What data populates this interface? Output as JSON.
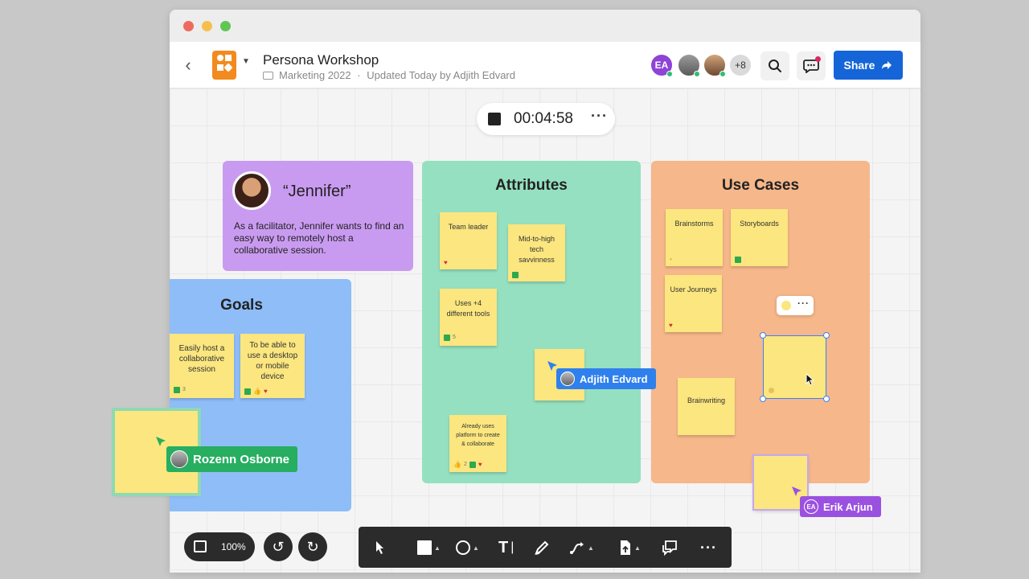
{
  "window": {
    "title": "Persona Workshop",
    "folder": "Marketing 2022",
    "updated": "Updated Today by Adjith Edvard"
  },
  "header": {
    "avatar_initials": "EA",
    "more_collaborators": "+8",
    "share_label": "Share"
  },
  "timer": {
    "time": "00:04:58"
  },
  "persona": {
    "name": "“Jennifer”",
    "description": "As a facilitator, Jennifer wants to find an easy way to remotely host a collaborative session."
  },
  "frames": {
    "attributes_title": "Attributes",
    "usecases_title": "Use Cases",
    "goals_title": "Goals"
  },
  "stickies": {
    "team_leader": "Team leader",
    "tech_savvy": "Mid-to-high tech savvinness",
    "uses_tools": "Uses +4 different tools",
    "uses_tools_votes": "5",
    "already_uses": "Already uses platform to create & collaborate",
    "already_uses_votes": "2",
    "brainstorms": "Brainstorms",
    "storyboards": "Storyboards",
    "user_journeys": "User Journeys",
    "brainwriting": "Brainwriting",
    "easily_host": "Easily host a collaborative session",
    "easily_host_votes": "3",
    "desktop_mobile": "To be able to use a desktop or mobile device"
  },
  "cursors": {
    "adjith": "Adjith Edvard",
    "rozenn": "Rozenn Osborne",
    "erik": "Erik Arjun",
    "erik_initials": "EA"
  },
  "bottom": {
    "zoom": "100%"
  },
  "colors": {
    "share_blue": "#1565d8",
    "persona_purple": "#c99bf0",
    "attributes_green": "#95e0c0",
    "usecases_orange": "#f6b78a",
    "goals_blue": "#8ebdf8",
    "sticky_yellow": "#fbe67f",
    "cursor_blue": "#2f80ed",
    "cursor_green": "#27ae60",
    "cursor_purple": "#9b51e0"
  }
}
